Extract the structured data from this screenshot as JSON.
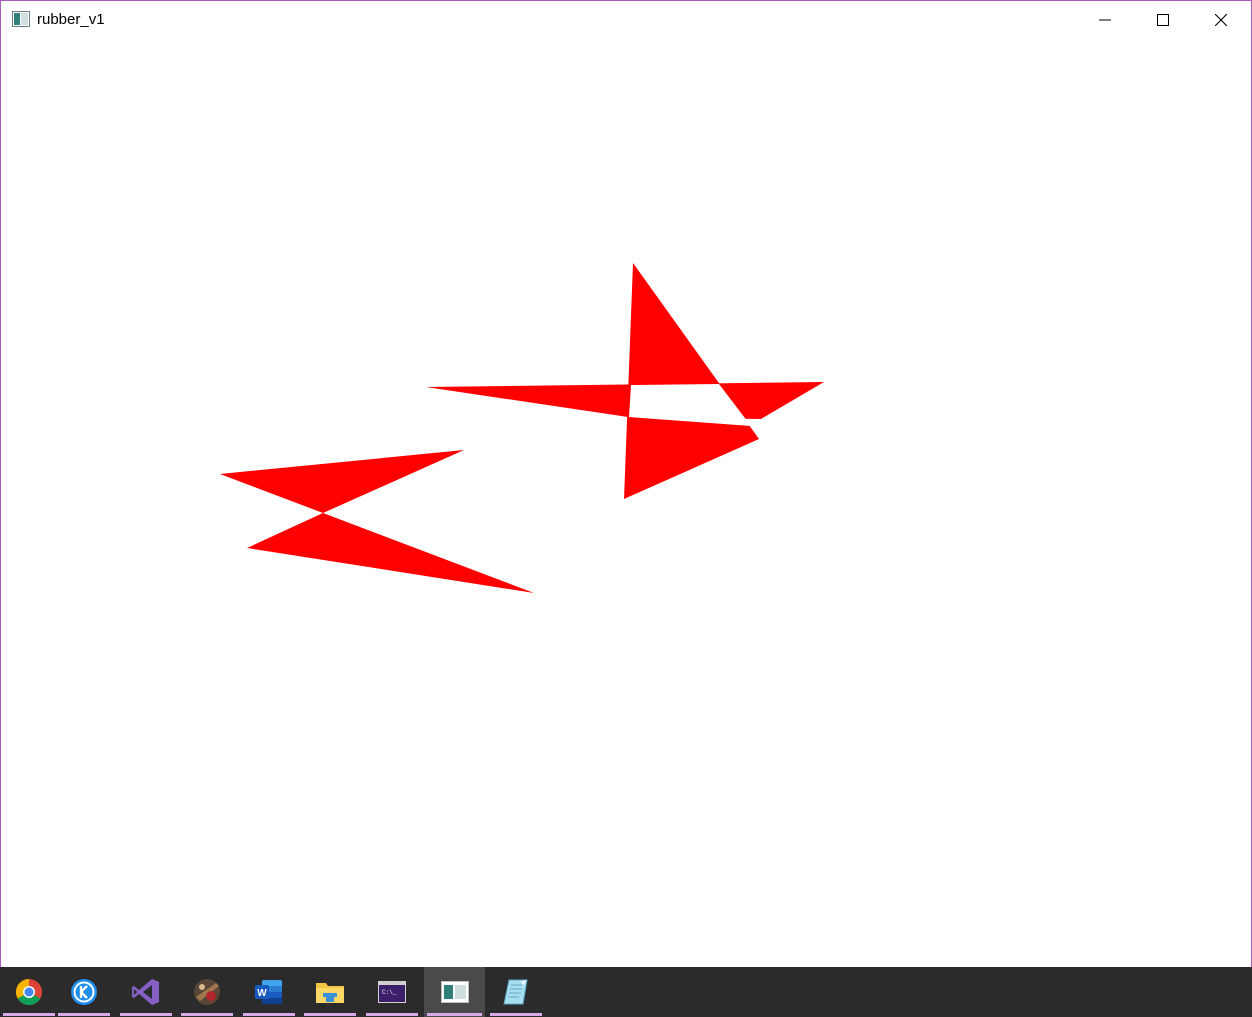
{
  "window": {
    "title": "rubber_v1",
    "controls": {
      "minimize": "minimize-icon",
      "maximize": "maximize-icon",
      "close": "close-icon"
    },
    "border_color": "#a35fb6"
  },
  "canvas": {
    "background": "#ffffff",
    "fill_color": "#ff0000",
    "shapes": [
      "zigzag-shape",
      "star-shape"
    ]
  },
  "taskbar": {
    "background": "#2b2b2b",
    "items": [
      {
        "name": "chrome",
        "icon": "chrome-icon",
        "running": true
      },
      {
        "name": "kugou",
        "icon": "kugou-icon",
        "running": true
      },
      {
        "name": "visual-studio",
        "icon": "visual-studio-icon",
        "running": true
      },
      {
        "name": "game",
        "icon": "game-icon",
        "running": true
      },
      {
        "name": "word",
        "icon": "word-icon",
        "running": true
      },
      {
        "name": "file-explorer",
        "icon": "folder-icon",
        "running": true
      },
      {
        "name": "console",
        "icon": "console-icon",
        "running": true
      },
      {
        "name": "rubber-v1",
        "icon": "opengl-window-icon",
        "running": true,
        "active": true
      },
      {
        "name": "notepad",
        "icon": "notepad-icon",
        "running": true
      }
    ]
  }
}
